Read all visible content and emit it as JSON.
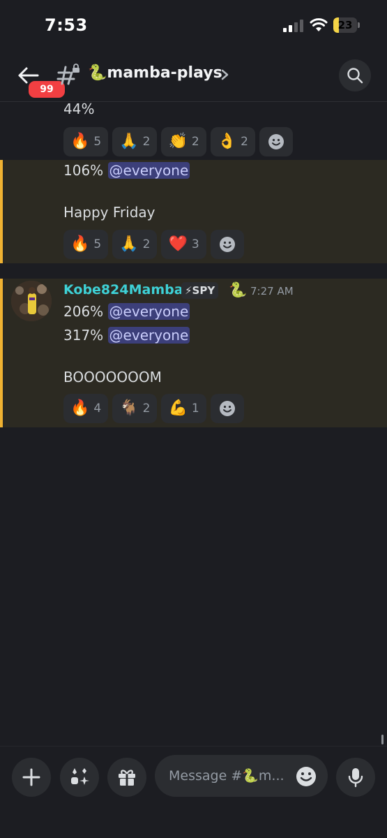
{
  "status_bar": {
    "time": "7:53",
    "battery": "23",
    "battery_level": 0.23
  },
  "header": {
    "back_badge": "99",
    "channel_name": "🐍mamba-plays"
  },
  "messages": [
    {
      "lines": [
        "44%"
      ],
      "reactions": [
        {
          "emoji": "🔥",
          "count": "5"
        },
        {
          "emoji": "🙏",
          "count": "2"
        },
        {
          "emoji": "👏",
          "count": "2"
        },
        {
          "emoji": "👌",
          "count": "2"
        }
      ]
    },
    {
      "line1_text": "106%",
      "line1_mention": "@everyone",
      "line2": "Happy Friday",
      "reactions": [
        {
          "emoji": "🔥",
          "count": "5"
        },
        {
          "emoji": "🙏",
          "count": "2"
        },
        {
          "emoji": "❤️",
          "count": "3"
        }
      ]
    },
    {
      "author": "Kobe824Mamba",
      "role_tag": "⚡SPY",
      "author_emoji": "🐍",
      "timestamp": "7:27 AM",
      "line1_text": "206%",
      "line1_mention": "@everyone",
      "line2_text": "317%",
      "line2_mention": "@everyone",
      "line3": "BOOOOOOOM",
      "reactions": [
        {
          "emoji": "🔥",
          "count": "4"
        },
        {
          "emoji": "🐐",
          "count": "2"
        },
        {
          "emoji": "💪",
          "count": "1"
        }
      ]
    }
  ],
  "composer": {
    "placeholder": "Message #🐍m..."
  },
  "icons": {
    "back": "arrow-left-icon",
    "channel": "locked-hash-icon",
    "search": "search-icon",
    "add_reaction": "smiley-plus-icon",
    "plus": "plus-icon",
    "apps": "apps-icon",
    "gift": "gift-icon",
    "emoji": "emoji-icon",
    "mic": "microphone-icon"
  },
  "colors": {
    "accent_username": "#3ed1d6",
    "highlight_border": "#f0b232",
    "badge": "#f23f42",
    "mention_bg": "#3c3f7a"
  }
}
